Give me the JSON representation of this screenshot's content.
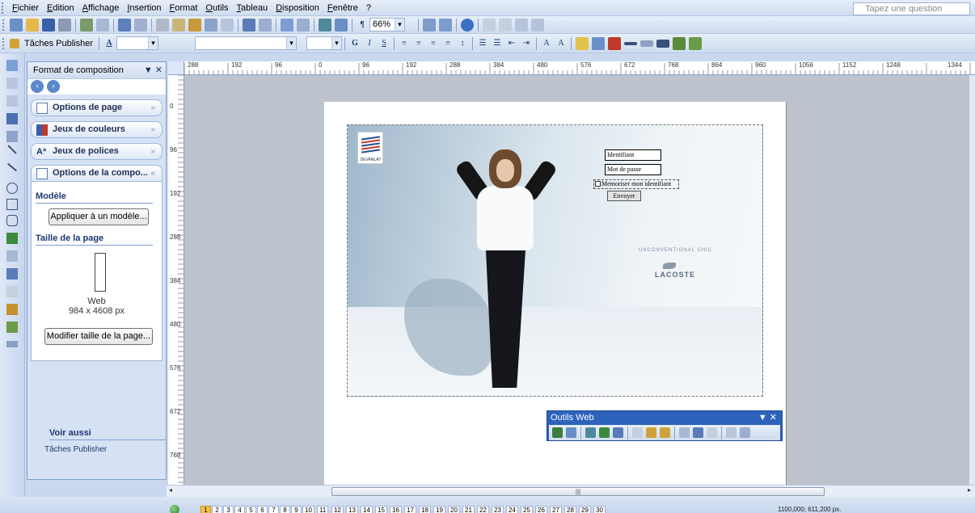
{
  "menu": [
    "Fichier",
    "Edition",
    "Affichage",
    "Insertion",
    "Format",
    "Outils",
    "Tableau",
    "Disposition",
    "Fenêtre",
    "?"
  ],
  "ask_question_placeholder": "Tapez une question",
  "toolbar": {
    "zoom": "66%",
    "task_label": "Tâches Publisher"
  },
  "colors": {
    "accent": "#2d63bd",
    "menubar": "#cfdcef",
    "workspace": "#bcc3cd",
    "active_page": "#f5c044"
  },
  "task_pane": {
    "title": "Format de composition",
    "sections": [
      "Options de page",
      "Jeux de couleurs",
      "Jeux de polices",
      "Options de la compo..."
    ],
    "modele_label": "Modèle",
    "apply_template_button": "Appliquer à un modèle...",
    "page_size_label": "Taille de la page",
    "page_type": "Web",
    "page_dimensions": "984 x 4608 px",
    "modify_size_button": "Modifier taille de la page...",
    "voir_aussi": "Voir aussi",
    "taches_link": "Tâches Publisher"
  },
  "ruler_top_labels": [
    "288",
    "192",
    "96",
    "0",
    "96",
    "192",
    "288",
    "384",
    "480",
    "576",
    "672",
    "768",
    "864",
    "960",
    "1056",
    "1152",
    "1248",
    "1344"
  ],
  "ruler_left_labels": [
    "0",
    "96",
    "192",
    "288",
    "384",
    "480",
    "576",
    "672",
    "768"
  ],
  "page_content": {
    "brand_logo_text": "DEVANLAY",
    "login_id_field": "Identifiant",
    "password_field": "Mot de passe",
    "remember_label": "Memoriser mon identifiant",
    "submit_button": "Envoyer",
    "tagline": "UNCONVENTIONAL CHIC",
    "brand": "LACOSTE"
  },
  "web_tools": {
    "title": "Outils Web"
  },
  "pages": [
    "1",
    "2",
    "3",
    "4",
    "5",
    "6",
    "7",
    "8",
    "9",
    "10",
    "11",
    "12",
    "13",
    "14",
    "15",
    "16",
    "17",
    "18",
    "19",
    "20",
    "21",
    "22",
    "23",
    "24",
    "25",
    "26",
    "27",
    "28",
    "29",
    "30"
  ],
  "active_page": "1",
  "cursor_position": "1100,000; 611,200 px."
}
